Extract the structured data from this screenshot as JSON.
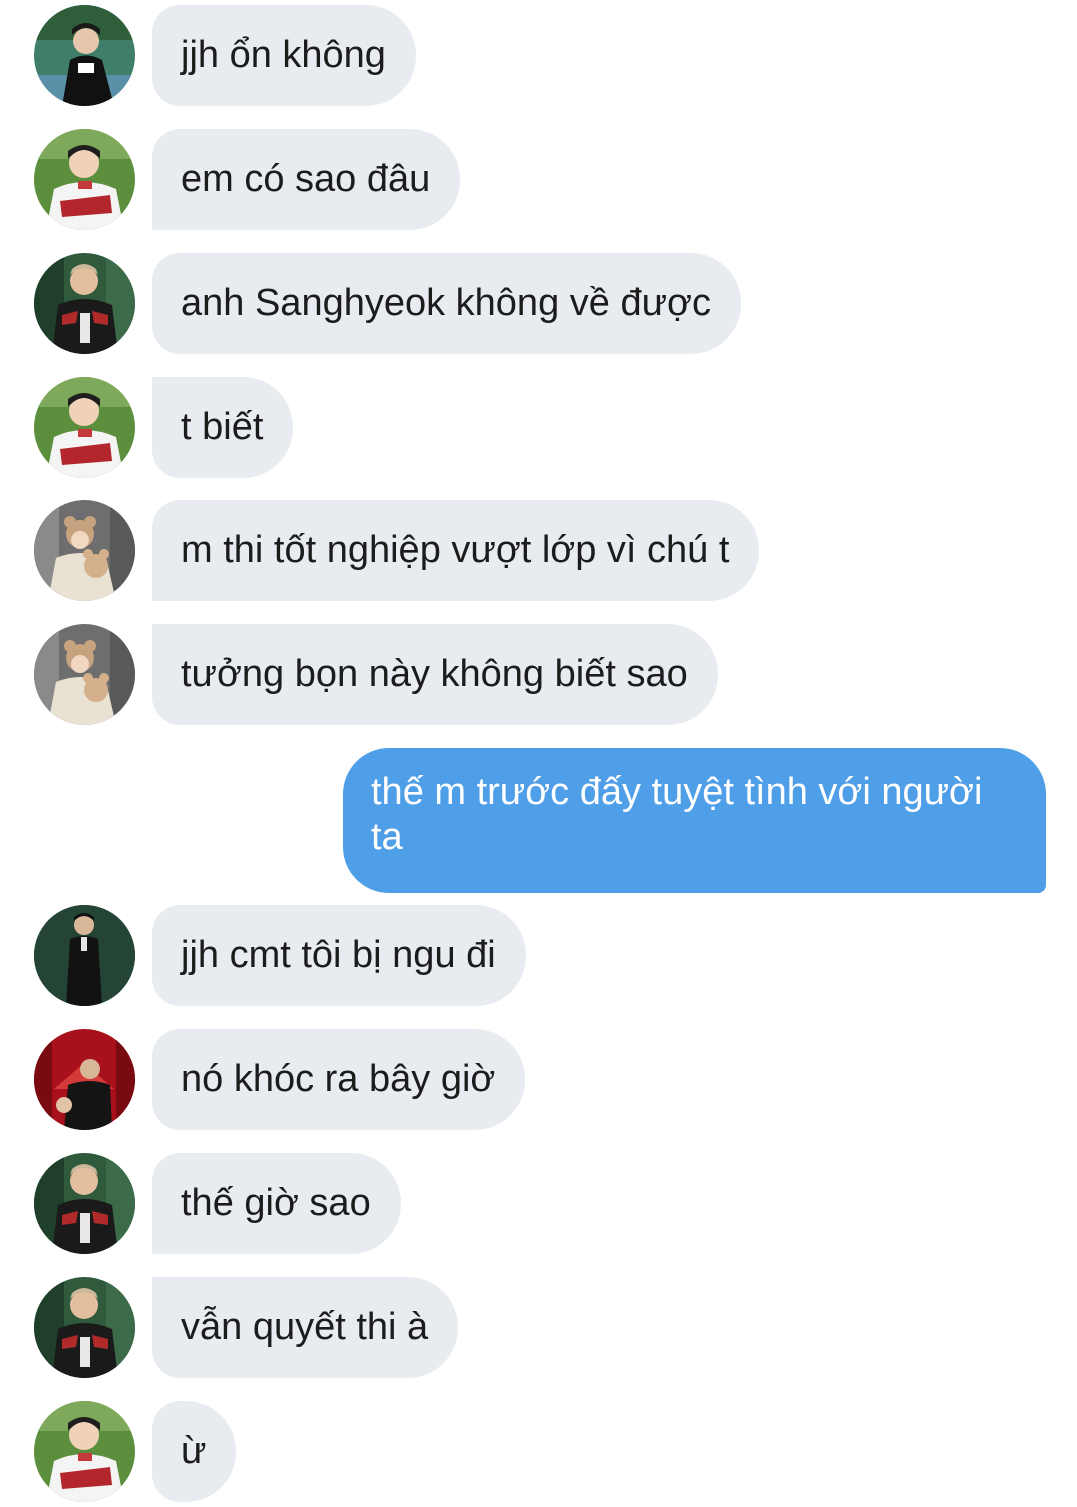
{
  "messages": [
    {
      "text": "jjh ổn không",
      "sender": "avatar-1"
    },
    {
      "text": "em có sao đâu",
      "sender": "avatar-2"
    },
    {
      "text": "anh Sanghyeok không về được",
      "sender": "avatar-3"
    },
    {
      "text": "t biết",
      "sender": "avatar-2"
    },
    {
      "text": "m thi tốt nghiệp vượt lớp vì chú t",
      "sender": "avatar-4"
    },
    {
      "text": "tưởng bọn này không biết sao",
      "sender": "avatar-4"
    },
    {
      "text": "thế m trước đấy tuyệt tình với người ta",
      "sender": "me"
    },
    {
      "text": "jjh cmt tôi bị ngu đi",
      "sender": "avatar-5"
    },
    {
      "text": "nó khóc ra bây giờ",
      "sender": "avatar-6"
    },
    {
      "text": "thế giờ sao",
      "sender": "avatar-3"
    },
    {
      "text": "vẫn quyết thi à",
      "sender": "avatar-3"
    },
    {
      "text": "ừ",
      "sender": "avatar-2"
    }
  ],
  "colors": {
    "incoming_bubble": "#e8ecf0",
    "outgoing_bubble": "#4f9ee8",
    "incoming_text": "#1c1c1c",
    "outgoing_text": "#ffffff"
  }
}
